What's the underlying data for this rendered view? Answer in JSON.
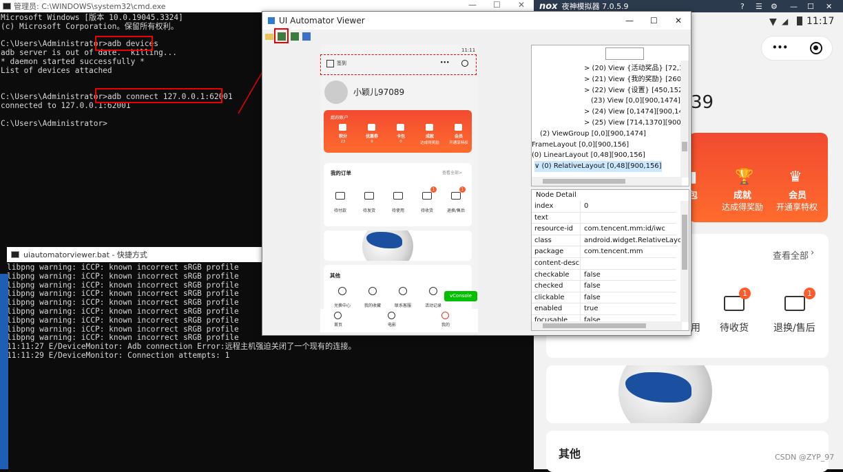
{
  "cmd": {
    "title": "管理员: C:\\WINDOWS\\system32\\cmd.exe",
    "lines": [
      "Microsoft Windows [版本 10.0.19045.3324]",
      "(c) Microsoft Corporation。保留所有权利。",
      "",
      "C:\\Users\\Administrator>adb devices",
      "adb server is out of date.  killing...",
      "* daemon started successfully *",
      "List of devices attached",
      "",
      "",
      "C:\\Users\\Administrator>adb connect 127.0.0.1:62001",
      "connected to 127.0.0.1:62001",
      "",
      "C:\\Users\\Administrator>"
    ],
    "minimize": "—",
    "maximize": "☐",
    "close": "✕"
  },
  "bat": {
    "title": "uiautomatorviewer.bat - 快捷方式",
    "lines": [
      "libpng warning: iCCP: known incorrect sRGB profile",
      "libpng warning: iCCP: known incorrect sRGB profile",
      "libpng warning: iCCP: known incorrect sRGB profile",
      "libpng warning: iCCP: known incorrect sRGB profile",
      "libpng warning: iCCP: known incorrect sRGB profile",
      "libpng warning: iCCP: known incorrect sRGB profile",
      "libpng warning: iCCP: known incorrect sRGB profile",
      "libpng warning: iCCP: known incorrect sRGB profile",
      "libpng warning: iCCP: known incorrect sRGB profile",
      "11:11:27 E/DeviceMonitor: Adb connection Error:远程主机强迫关闭了一个现有的连接。",
      "11:11:29 E/DeviceMonitor: Connection attempts: 1"
    ]
  },
  "nox": {
    "title": "夜神模拟器 7.0.5.9",
    "logo": "nox",
    "time": "11:17",
    "more": "•••",
    "partial_name": "39",
    "stat_labels": [
      {
        "top": "成就",
        "sub": "达成得奖励"
      },
      {
        "top": "会员",
        "sub": "开通享特权"
      }
    ],
    "view_all": "查看全部",
    "orders": [
      "待收货",
      "退换/售后"
    ],
    "badge": "1",
    "partial_tab": "用",
    "others_title": "其他",
    "watermark": "CSDN @ZYP_97"
  },
  "automator": {
    "title": "UI Automator Viewer",
    "minimize": "—",
    "maximize": "☐",
    "close": "✕",
    "tree": [
      "> (20) View {活动奖品} [72,1",
      "> (21) View {我的奖励} [260,",
      "> (22) View {设置} [450,1526",
      "(23) View [0,0][900,1474]",
      "> (24) View [0,1474][900,14",
      "> (25) View [714,1370][900,",
      "(2) ViewGroup [0,0][900,1474]",
      "FrameLayout [0,0][900,156]",
      "(0) LinearLayout [0,48][900,156]",
      "∨ (0) RelativeLayout [0,48][900,156]"
    ],
    "node_detail_title": "Node Detail",
    "node_detail": [
      {
        "k": "index",
        "v": "0"
      },
      {
        "k": "text",
        "v": ""
      },
      {
        "k": "resource-id",
        "v": "com.tencent.mm:id/iwc"
      },
      {
        "k": "class",
        "v": "android.widget.RelativeLayou"
      },
      {
        "k": "package",
        "v": "com.tencent.mm"
      },
      {
        "k": "content-desc",
        "v": ""
      },
      {
        "k": "checkable",
        "v": "false"
      },
      {
        "k": "checked",
        "v": "false"
      },
      {
        "k": "clickable",
        "v": "false"
      },
      {
        "k": "enabled",
        "v": "true"
      },
      {
        "k": "focusable",
        "v": "false"
      }
    ]
  },
  "phone": {
    "time": "11:11",
    "checkin": "签到",
    "more": "•••",
    "username": "小颖儿97089",
    "account": "我的账户",
    "stats": [
      {
        "label": "积分",
        "val": "23"
      },
      {
        "label": "优惠券",
        "val": "0"
      },
      {
        "label": "卡包",
        "val": "0"
      },
      {
        "label": "成就",
        "val": "达成得奖励"
      },
      {
        "label": "会员",
        "val": "开通享特权"
      }
    ],
    "orders_title": "我的订单",
    "orders_all": "查看全部>",
    "orders": [
      "待付款",
      "待发货",
      "待使用",
      "待收货",
      "退换/售后"
    ],
    "badge": "1",
    "others_title": "其他",
    "others": [
      "兑换中心",
      "我的收藏",
      "联系客服",
      "活动记录"
    ],
    "vconsole": "vConsole",
    "tabs": [
      "首页",
      "电影",
      "我的"
    ]
  },
  "colors": {
    "accent_red": "#e53b2c",
    "console_bg": "#0c0c0c",
    "orange": "#ff6a2c"
  }
}
